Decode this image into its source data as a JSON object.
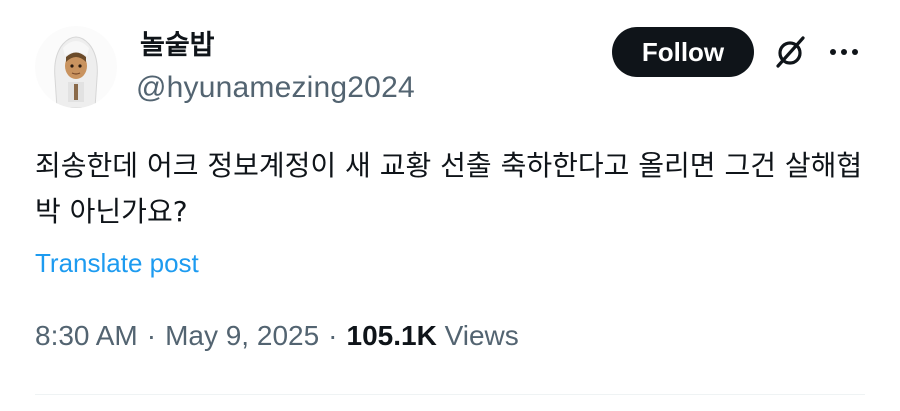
{
  "author": {
    "display_name": "놀숱밥",
    "handle": "@hyunamezing2024",
    "avatar_icon": "person-avatar"
  },
  "header": {
    "follow_label": "Follow",
    "grok_icon": "slashed-circle-icon",
    "more_icon": "ellipsis-icon"
  },
  "post": {
    "text": "죄송한데 어크 정보계정이 새 교황 선출 축하한다고 올리면 그건 살해협박 아닌가요?",
    "translate_label": "Translate post"
  },
  "meta": {
    "time": "8:30 AM",
    "separator": "·",
    "date": "May 9, 2025",
    "views_count": "105.1K",
    "views_label": "Views"
  },
  "colors": {
    "text_primary": "#0f1419",
    "text_secondary": "#536471",
    "link": "#1d9bf0",
    "button_bg": "#0f1419"
  }
}
